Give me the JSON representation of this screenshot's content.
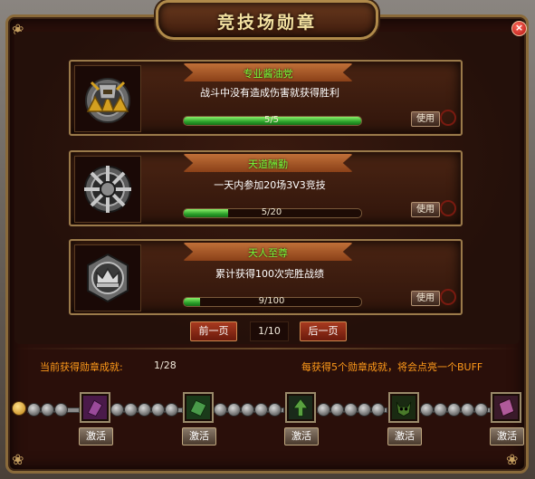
{
  "window": {
    "title": "竞技场勋章",
    "close_label": "×"
  },
  "medals": [
    {
      "name": "专业酱油党",
      "description": "战斗中没有造成伤害就获得胜利",
      "progress_text": "5/5",
      "progress_fraction": 1.0,
      "use_label": "使用",
      "icon": "helmet-medal-icon"
    },
    {
      "name": "天道酬勤",
      "description": "一天内参加20场3V3竞技",
      "progress_text": "5/20",
      "progress_fraction": 0.25,
      "use_label": "使用",
      "icon": "wheel-medal-icon"
    },
    {
      "name": "天人至尊",
      "description": "累计获得100次完胜战绩",
      "progress_text": "9/100",
      "progress_fraction": 0.09,
      "use_label": "使用",
      "icon": "crown-medal-icon"
    }
  ],
  "pager": {
    "prev_label": "前一页",
    "page_text": "1/10",
    "next_label": "后一页"
  },
  "summary": {
    "label": "当前获得勋章成就:",
    "count": "1/28",
    "hint": "每获得5个勋章成就，将会点亮一个BUFF"
  },
  "rewards": [
    {
      "icon": "purple-scroll-icon",
      "activate_label": "激活",
      "color": "#6a2a6a"
    },
    {
      "icon": "green-scroll-icon",
      "activate_label": "激活",
      "color": "#2a6a2a"
    },
    {
      "icon": "green-arrow-icon",
      "activate_label": "激活",
      "color": "#2a5a2a"
    },
    {
      "icon": "demon-face-icon",
      "activate_label": "激活",
      "color": "#2a4a2a"
    },
    {
      "icon": "pink-card-icon",
      "activate_label": "激活",
      "color": "#7a3a6a"
    }
  ],
  "colors": {
    "accent_orange": "#ff9a1a",
    "medal_name_green": "#7cff3a",
    "progress_green": "#2aa02a"
  }
}
